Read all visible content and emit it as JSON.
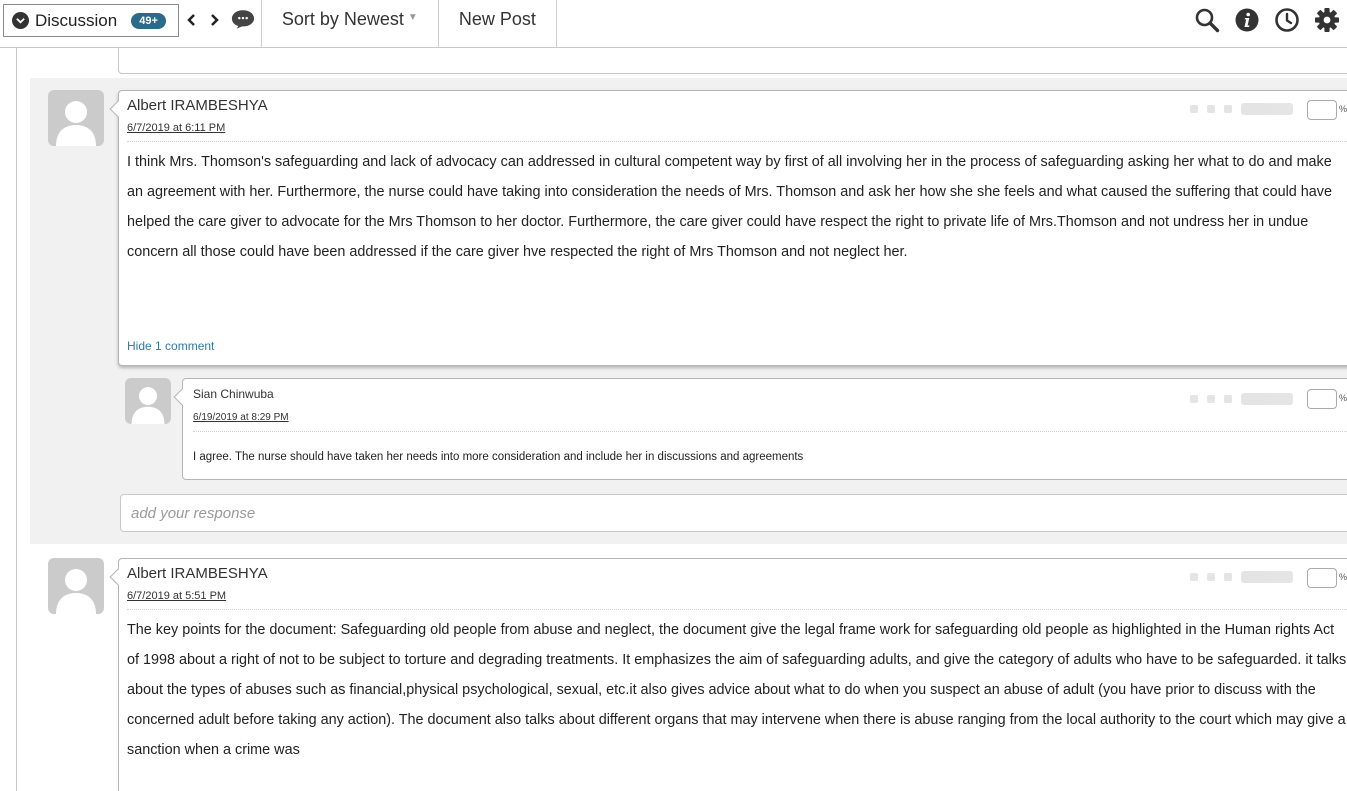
{
  "toolbar": {
    "discussion_label": "Discussion",
    "count_badge": "49+",
    "sort_label": "Sort by Newest",
    "new_post_label": "New Post",
    "icons": [
      "chevron-down-icon",
      "prev-arrow-icon",
      "next-arrow-icon",
      "chat-bubble-icon",
      "search-icon",
      "info-icon",
      "history-clock-icon",
      "settings-gear-icon"
    ]
  },
  "posts": [
    {
      "author": "Albert IRAMBESHYA",
      "date": "6/7/2019 at 6:11 PM",
      "body": "I think Mrs. Thomson's safeguarding and lack of advocacy can addressed in cultural competent way by first of all involving her in the process of safeguarding asking her what to do and make an agreement with her. Furthermore, the nurse could have taking into consideration the needs of Mrs. Thomson and ask her how she she feels and what caused the suffering that could have helped the care giver to advocate for the Mrs Thomson to her doctor. Furthermore, the care giver could have respect the right to private life of Mrs.Thomson and not undress her in undue concern all those could have been addressed if the care giver hve respected the right of Mrs Thomson and not neglect her.",
      "hide_comments_label": "Hide 1 comment",
      "pct_label": "%",
      "comments": [
        {
          "author": "Sian Chinwuba",
          "date": "6/19/2019 at 8:29 PM",
          "body": "I agree. The nurse should have taken her needs into more consideration and include her in discussions and agreements",
          "pct_label": "%"
        }
      ],
      "response_placeholder": "add your response"
    },
    {
      "author": "Albert IRAMBESHYA",
      "date": "6/7/2019 at 5:51 PM",
      "body": "The key points for the document: Safeguarding old people from abuse and neglect, the document give the legal frame work for safeguarding old people as highlighted in the Human rights Act of 1998 about a right of not to be subject to torture and degrading treatments. It emphasizes the aim of safeguarding adults, and give the category of adults who have to be safeguarded. it talks about the types of abuses such as financial,physical psychological, sexual, etc.it also gives advice about what to do when you suspect an abuse of adult (you have prior to discuss with the concerned adult before taking any action). The document also talks about different organs that may intervene when there is abuse ranging from the local authority to the court which may give a sanction when a crime was",
      "pct_label": "%"
    }
  ],
  "colors": {
    "badge": "#2b6b8a",
    "link": "#2a7ba8",
    "thread_bg": "#f1f1f1"
  }
}
